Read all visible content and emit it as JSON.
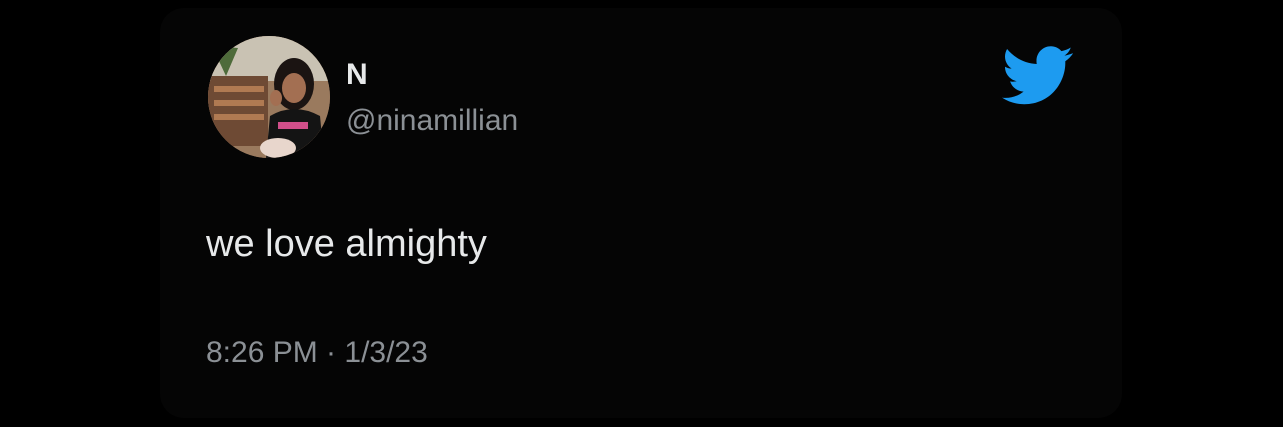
{
  "author": {
    "display_name": "N",
    "handle": "@ninamillian",
    "avatar": "profile-photo"
  },
  "tweet": {
    "text": "we love almighty",
    "timestamp": "8:26 PM · 1/3/23"
  },
  "brand": {
    "logo": "twitter-bird-icon",
    "color": "#1d9bf0"
  },
  "colors": {
    "background": "#000000",
    "primary_text": "#e7e9ea",
    "secondary_text": "#8b9095"
  }
}
